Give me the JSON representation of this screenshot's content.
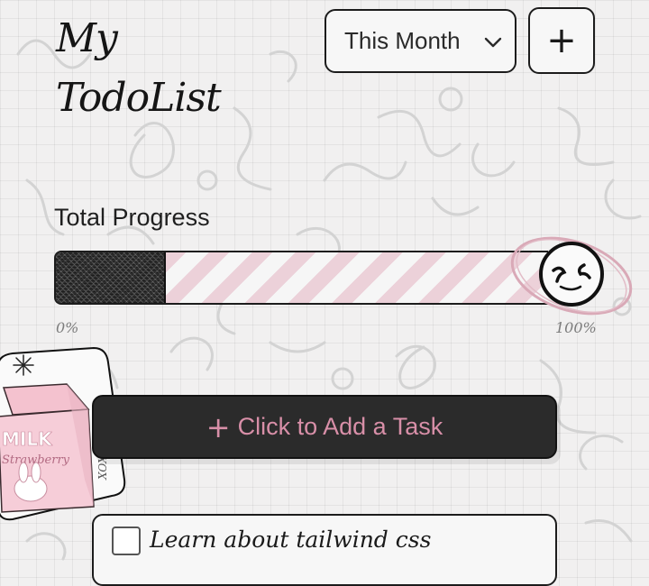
{
  "header": {
    "title_line1": "My",
    "title_line2": "TodoList",
    "period_select": {
      "value": "This Month",
      "icon": "chevron-down-icon"
    },
    "add_button": {
      "label": "+",
      "icon": "plus-icon"
    }
  },
  "progress": {
    "label": "Total Progress",
    "value": 0.22,
    "min_label": "0%",
    "max_label": "100%",
    "fill_color": "#2c2c2c",
    "stripe_color": "#ecd1d9",
    "indicator_icon": "smiley-face-icon"
  },
  "add_task": {
    "plus": "+",
    "label": "Click to Add a Task",
    "color": "#d88fa8"
  },
  "tasks": [
    {
      "text": "Learn about tailwind css",
      "done": false
    }
  ],
  "sticker": {
    "line1": "MILK",
    "line2": "Strawberry",
    "side": "XOXO",
    "icon": "strawberry-milk-sticker"
  },
  "colors": {
    "background": "#f1f0f0",
    "accent_pink": "#d88fa8",
    "dark": "#2b2b2b"
  }
}
